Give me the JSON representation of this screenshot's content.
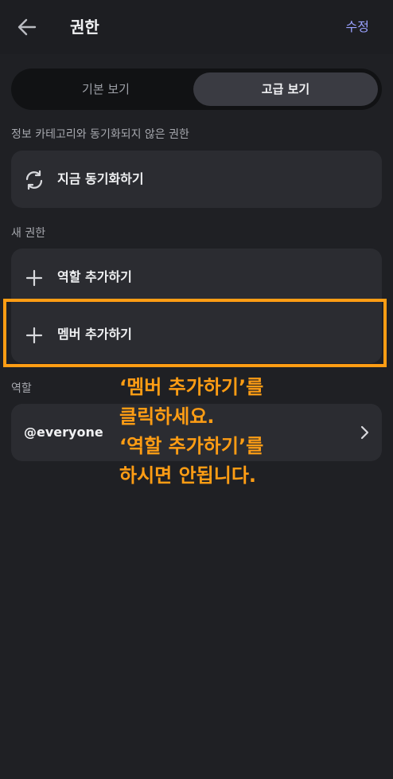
{
  "header": {
    "title": "권한",
    "edit_label": "수정",
    "back_icon": "arrow-left-icon"
  },
  "view_toggle": {
    "basic_label": "기본 보기",
    "advanced_label": "고급 보기",
    "selected": "advanced"
  },
  "sync_section": {
    "label": "정보 카테고리와 동기화되지 않은 권한",
    "sync_label": "지금 동기화하기",
    "icon": "sync-icon"
  },
  "new_permission_section": {
    "label": "새 권한",
    "items": [
      {
        "label": "역할 추가하기",
        "icon": "plus-icon"
      },
      {
        "label": "멤버 추가하기",
        "icon": "plus-icon",
        "highlighted": true
      }
    ]
  },
  "roles_section": {
    "label": "역할",
    "items": [
      {
        "label": "@everyone",
        "icon": "chevron-right-icon"
      }
    ]
  },
  "annotation": {
    "lines": [
      "‘멤버 추가하기’를",
      "클릭하세요.",
      "‘역할 추가하기’를",
      "하시면 안됩니다."
    ],
    "color": "#ff9d14"
  },
  "colors": {
    "background": "#1f2024",
    "card": "#2b2c31",
    "accent": "#9aa2ff",
    "highlight": "#ff9d14"
  }
}
